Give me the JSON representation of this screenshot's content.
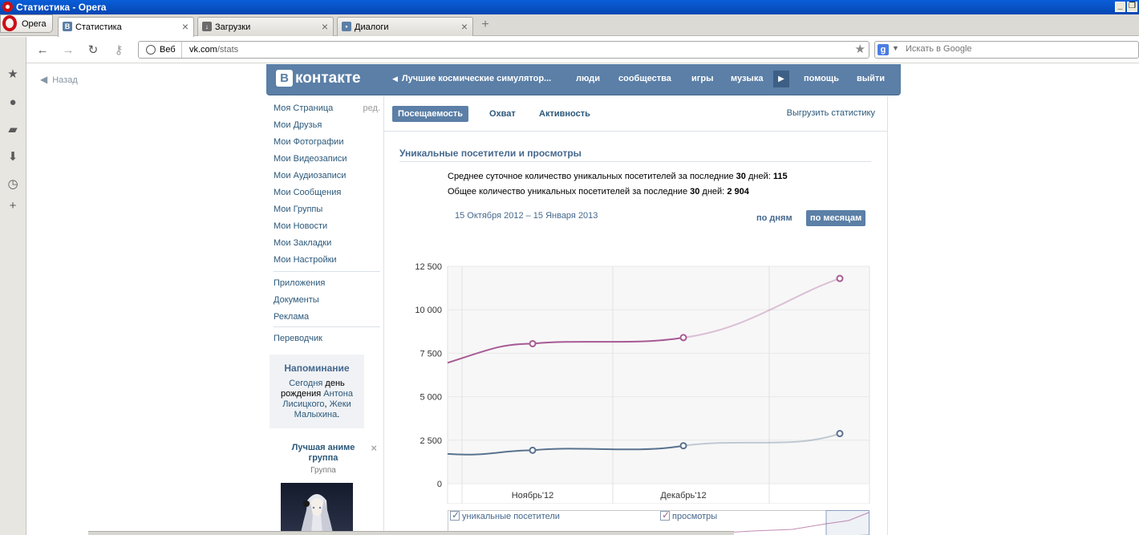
{
  "window": {
    "title": "Статистика - Opera"
  },
  "browser": {
    "menu_label": "Opera",
    "tabs": [
      {
        "label": "Статистика",
        "icon": "vk-favicon"
      },
      {
        "label": "Загрузки",
        "icon": "downloads-icon"
      },
      {
        "label": "Диалоги",
        "icon": "dialogs-icon"
      }
    ],
    "address": {
      "mode_label": "Веб",
      "url_domain": "vk.com",
      "url_path": "/stats"
    },
    "search": {
      "placeholder": "Искать в Google"
    }
  },
  "page": {
    "back_label": "Назад",
    "header": {
      "logo_text": "контакте",
      "logo_letter": "В",
      "nav": [
        "Лучшие космические симулятор...",
        "люди",
        "сообщества",
        "игры",
        "музыка",
        "помощь",
        "выйти"
      ]
    },
    "left_menu": {
      "edit_label": "ред.",
      "group1": [
        "Моя Страница",
        "Мои Друзья",
        "Мои Фотографии",
        "Мои Видеозаписи",
        "Мои Аудиозаписи",
        "Мои Сообщения",
        "Мои Группы",
        "Мои Новости",
        "Мои Закладки",
        "Мои Настройки"
      ],
      "group2": [
        "Приложения",
        "Документы",
        "Реклама"
      ],
      "group3": [
        "Переводчик"
      ]
    },
    "reminder": {
      "title": "Напоминание",
      "today": "Сегодня",
      "text1": " день рождения ",
      "name1": "Антона Лисицкого",
      "comma": ", ",
      "name2": "Жеки Малыхина",
      "dot": "."
    },
    "ad": {
      "title": "Лучшая аниме группа",
      "subtitle": "Группа"
    },
    "stats": {
      "tabs": [
        "Посещаемость",
        "Охват",
        "Активность"
      ],
      "export_label": "Выгрузить статистику",
      "section_title": "Уникальные посетители и просмотры",
      "line1_prefix": "Среднее суточное количество уникальных посетителей за последние ",
      "line1_days": "30",
      "line1_mid": " дней: ",
      "line1_value": "115",
      "line2_prefix": "Общее количество уникальных посетителей за последние ",
      "line2_days": "30",
      "line2_mid": " дней: ",
      "line2_value": "2 904",
      "date_range": "15 Октября 2012 – 15 Января 2013",
      "period_day": "по дням",
      "period_month": "по месяцам",
      "legend_visitors": "уникальные посетители",
      "legend_views": "просмотры"
    }
  },
  "colors": {
    "vk_blue": "#5b7fa6",
    "views": "#a75a94",
    "visitors": "#58728f"
  },
  "chart_data": {
    "type": "line",
    "categories": [
      "Ноябрь'12",
      "Декабрь'12",
      ""
    ],
    "ylim": [
      0,
      12500
    ],
    "yticks": [
      "0",
      "2 500",
      "5 000",
      "7 500",
      "10 000",
      "12 500"
    ],
    "grid": true,
    "series": [
      {
        "name": "просмотры",
        "values": [
          8050,
          8400,
          11800
        ]
      },
      {
        "name": "уникальные посетители",
        "values": [
          1920,
          2180,
          2880
        ]
      }
    ]
  }
}
